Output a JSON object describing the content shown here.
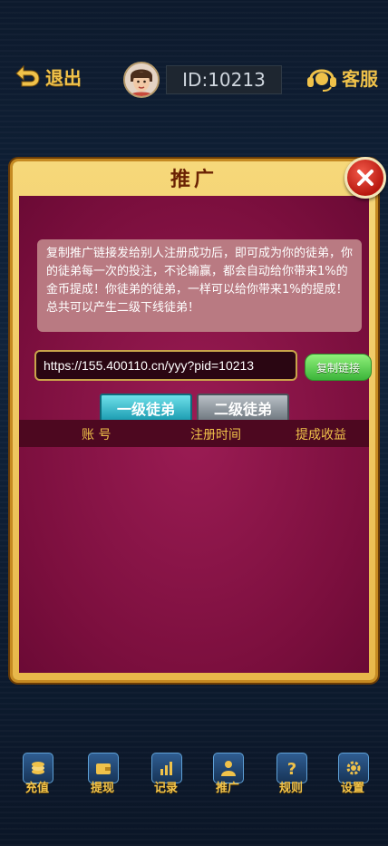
{
  "header": {
    "back_label": "退出",
    "id_text": "ID:10213",
    "service_label": "客服"
  },
  "dialog": {
    "title": "推广",
    "notice": "复制推广链接发给别人注册成功后，即可成为你的徒弟，你的徒弟每一次的投注，不论输赢，都会自动给你带来1%的金币提成！你徒弟的徒弟，一样可以给你带来1%的提成！总共可以产生二级下线徒弟！",
    "link_value": "https://155.400110.cn/yyy?pid=10213",
    "copy_label": "复制链接",
    "tabs": [
      {
        "label": "一级徒弟",
        "active": true
      },
      {
        "label": "二级徒弟",
        "active": false
      }
    ],
    "columns": [
      "账 号",
      "注册时间",
      "提成收益"
    ]
  },
  "bottom_nav": [
    {
      "label": "充值",
      "icon": "coin-icon"
    },
    {
      "label": "提现",
      "icon": "wallet-icon"
    },
    {
      "label": "记录",
      "icon": "chart-icon"
    },
    {
      "label": "推广",
      "icon": "user-icon"
    },
    {
      "label": "规则",
      "icon": "question-icon"
    },
    {
      "label": "设置",
      "icon": "gear-icon"
    }
  ],
  "colors": {
    "accent": "#f0c24a",
    "dialog_bg": "#7c0f3e",
    "dialog_frame": "#e8b84a"
  }
}
